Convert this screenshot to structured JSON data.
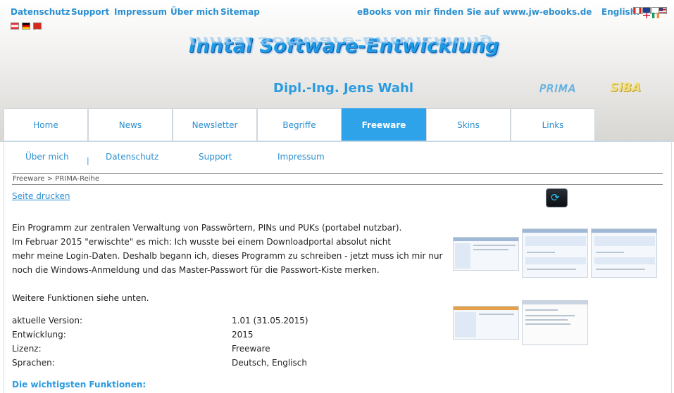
{
  "top_links": [
    "Datenschutz",
    "Support",
    "Impressum",
    "Über mich",
    "Sitemap"
  ],
  "ebooks_notice": "eBooks von mir finden Sie auf www.jw-ebooks.de",
  "language_label": "English:",
  "site_title": "Inntal Software-Entwicklung",
  "subtitle": "Dipl.-Ing. Jens Wahl",
  "logos": {
    "prima": "PRIMA",
    "siba": "SiBA"
  },
  "tabs": [
    "Home",
    "News",
    "Newsletter",
    "Begriffe",
    "Freeware",
    "Skins",
    "Links"
  ],
  "active_tab": "Freeware",
  "subnav": [
    "Über mich",
    "Datenschutz",
    "Support",
    "Impressum"
  ],
  "subnav_separator": "|",
  "breadcrumb": "Freeware > PRIMA-Reihe",
  "print_link": "Seite drucken",
  "description": [
    "Ein Programm zur zentralen Verwaltung von Passwörtern, PINs und PUKs (portabel nutzbar).",
    "Im Februar 2015 \"erwischte\" es mich: Ich wusste bei einem Downloadportal absolut nicht",
    "mehr meine Login-Daten. Deshalb begann ich, dieses Programm zu schreiben - jetzt muss ich mir nur",
    "noch die Windows-Anmeldung und das Master-Passwort für die Passwort-Kiste merken."
  ],
  "more_functions": "Weitere Funktionen siehe unten.",
  "info": [
    {
      "label": "aktuelle Version:",
      "value": "1.01 (31.05.2015)"
    },
    {
      "label": "Entwicklung:",
      "value": "2015"
    },
    {
      "label": "Lizenz:",
      "value": "Freeware"
    },
    {
      "label": "Sprachen:",
      "value": "Deutsch, Englisch"
    }
  ],
  "functions_heading": "Die wichtigsten Funktionen:",
  "icons": {
    "app_icon": "refresh-icon"
  },
  "colors": {
    "link": "#2b8fd0",
    "active_tab": "#2ea3ea",
    "title": "#1e9be6"
  }
}
